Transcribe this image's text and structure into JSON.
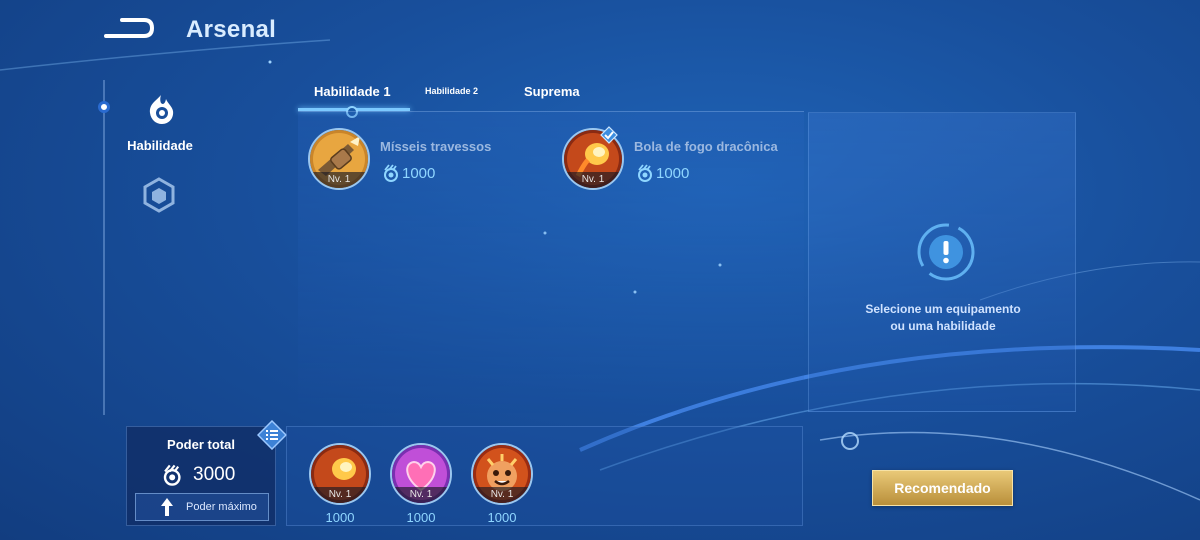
{
  "header": {
    "title": "Arsenal",
    "back_icon": "back-arrow-icon"
  },
  "sidebar": {
    "items": [
      {
        "label": "Habilidade",
        "icon": "flame-icon",
        "active": true
      },
      {
        "label": "",
        "icon": "emblem-shield-icon",
        "active": false
      }
    ]
  },
  "tabs": [
    {
      "label": "Habilidade 1",
      "active": true
    },
    {
      "label": "Habilidade 2",
      "active": false
    },
    {
      "label": "Suprema",
      "active": false
    }
  ],
  "skills": [
    {
      "name": "Mísseis travessos",
      "level": "Nv. 1",
      "cost": "1000",
      "icon": "missiles-icon",
      "selected": false
    },
    {
      "name": "Bola de fogo dracônica",
      "level": "Nv. 1",
      "cost": "1000",
      "icon": "dragon-fireball-icon",
      "selected": true
    }
  ],
  "info_panel": {
    "text_line1": "Selecione um equipamento",
    "text_line2": "ou uma habilidade",
    "icon": "alert-icon"
  },
  "power": {
    "title": "Poder total",
    "value": "3000",
    "max_button": "Poder máximo"
  },
  "equipped": [
    {
      "level": "Nv. 1",
      "cost": "1000",
      "icon": "fireball-icon"
    },
    {
      "level": "Nv. 1",
      "cost": "1000",
      "icon": "heart-icon"
    },
    {
      "level": "Nv. 1",
      "cost": "1000",
      "icon": "monkey-face-icon"
    }
  ],
  "recommend_button": "Recomendado",
  "colors": {
    "accent": "#7cc9ff",
    "gold": "#d4ad5a",
    "background": "#184f9c"
  }
}
